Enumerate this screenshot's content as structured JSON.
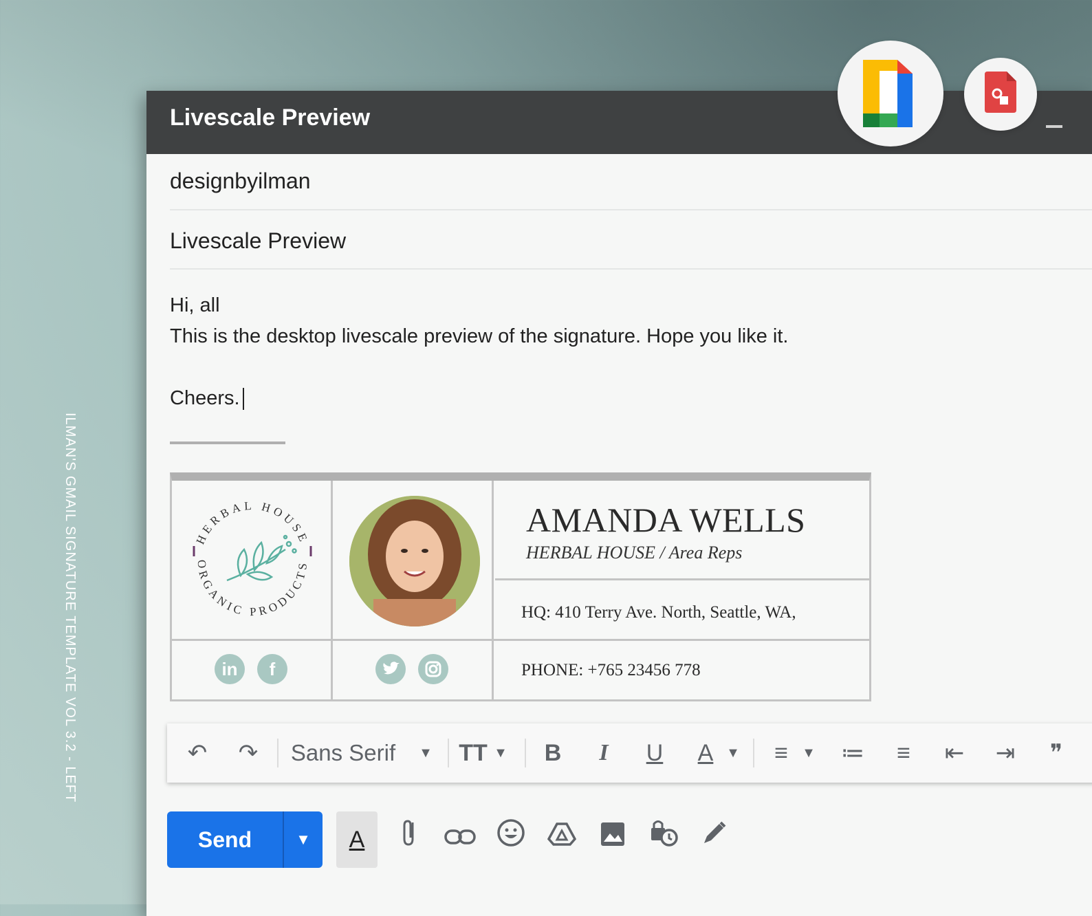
{
  "side_caption": "ILMAN'S GMAIL SIGNATURE TEMPLATE VOL 3.2 - LEFT",
  "window": {
    "title": "Livescale Preview",
    "minimize_label": "—"
  },
  "apps": [
    {
      "name": "Google Docs icon",
      "icon": "google-docs-icon"
    },
    {
      "name": "Google Slides icon",
      "icon": "google-slides-icon"
    }
  ],
  "compose": {
    "to": "designbyilman",
    "subject": "Livescale Preview",
    "body_line1": "Hi, all",
    "body_line2": "This is the desktop livescale preview of the signature. Hope you like it.",
    "body_line3": "Cheers."
  },
  "signature": {
    "logo_top_text": "HERBAL HOUSE",
    "logo_bottom_text": "ORGANIC PRODUCTS",
    "name": "AMANDA WELLS",
    "role": "HERBAL HOUSE / Area Reps",
    "hq": "HQ: 410 Terry Ave. North, Seattle, WA,",
    "phone": "PHONE: +765 23456 778",
    "socials": [
      "in",
      "f",
      "twitter",
      "instagram"
    ],
    "accent_color": "#a9c8c2"
  },
  "toolbar": {
    "undo": "↶",
    "redo": "↷",
    "font": "Sans Serif",
    "size": "TT",
    "bold": "B",
    "italic": "I",
    "underline": "U",
    "text_color": "A",
    "align": "≡",
    "numbered": "≔",
    "bulleted": "≡",
    "indent_less": "⇤",
    "indent_more": "⇥",
    "quote": "❞"
  },
  "send": {
    "label": "Send",
    "color": "#1a73e8"
  }
}
